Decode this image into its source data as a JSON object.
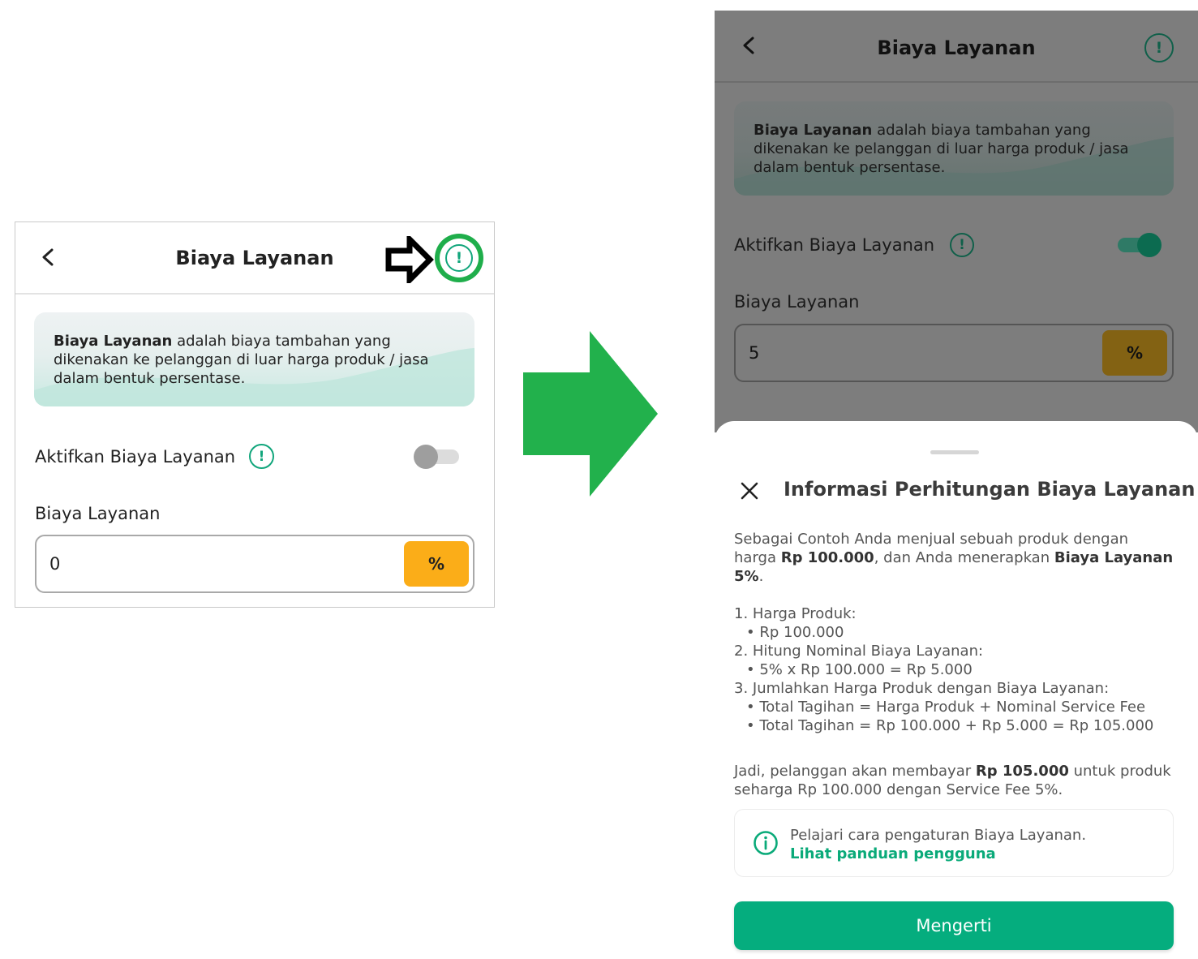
{
  "colors": {
    "brand_green": "#05ad7e",
    "accent_orange": "#fbad18",
    "highlight_green": "#1fae4b",
    "overlay_gray": "#7d7d7d"
  },
  "left_screen": {
    "header": {
      "title": "Biaya Layanan",
      "back_icon": "chevron-left-icon",
      "info_icon": "exclamation-circle-icon"
    },
    "info_card": {
      "bold_text": "Biaya Layanan",
      "text_line1": " adalah biaya tambahan yang",
      "text_line2": "dikenakan ke pelanggan di luar harga produk / jasa",
      "text_line3": "dalam bentuk persentase."
    },
    "toggle_row": {
      "label": "Aktifkan Biaya Layanan",
      "enabled": false
    },
    "fee_field": {
      "label": "Biaya Layanan",
      "value": "0",
      "unit": "%"
    }
  },
  "annotation": {
    "pointer_icon": "outline-arrow-right-icon",
    "transition_icon": "green-arrow-right-icon"
  },
  "right_screen": {
    "header": {
      "title": "Biaya Layanan",
      "back_icon": "chevron-left-icon",
      "info_icon": "exclamation-circle-icon"
    },
    "info_card": {
      "bold_text": "Biaya Layanan",
      "text_line1": " adalah biaya tambahan yang",
      "text_line2": "dikenakan ke pelanggan di luar harga produk / jasa",
      "text_line3": "dalam bentuk persentase."
    },
    "toggle_row": {
      "label": "Aktifkan Biaya Layanan",
      "enabled": true
    },
    "fee_field": {
      "label": "Biaya Layanan",
      "value": "5",
      "unit": "%"
    },
    "sheet": {
      "close_icon": "close-icon",
      "title": "Informasi Perhitungan Biaya Layanan",
      "intro_line1": "Sebagai Contoh Anda menjual sebuah produk dengan",
      "intro_line2_a": "harga ",
      "intro_line2_b": "Rp 100.000",
      "intro_line2_c": ", dan Anda menerapkan ",
      "intro_line2_d": "Biaya Layanan",
      "intro_line3_a": "5%",
      "intro_line3_b": ".",
      "steps": [
        "1. Harga Produk:",
        "• Rp 100.000",
        "2. Hitung Nominal Biaya Layanan:",
        "• 5% x Rp 100.000 = Rp 5.000",
        "3. Jumlahkan Harga Produk dengan Biaya Layanan:",
        "• Total Tagihan = Harga Produk + Nominal Service Fee",
        "• Total Tagihan = Rp 100.000 + Rp 5.000 = Rp 105.000"
      ],
      "conclusion_a": "Jadi, pelanggan akan membayar ",
      "conclusion_b": "Rp 105.000",
      "conclusion_c": " untuk produk",
      "conclusion_line2": "seharga Rp 100.000 dengan Service Fee 5%.",
      "guide_icon": "info-circle-icon",
      "guide_text": "Pelajari cara pengaturan Biaya Layanan.",
      "guide_link": "Lihat panduan pengguna",
      "confirm_button": "Mengerti"
    }
  }
}
